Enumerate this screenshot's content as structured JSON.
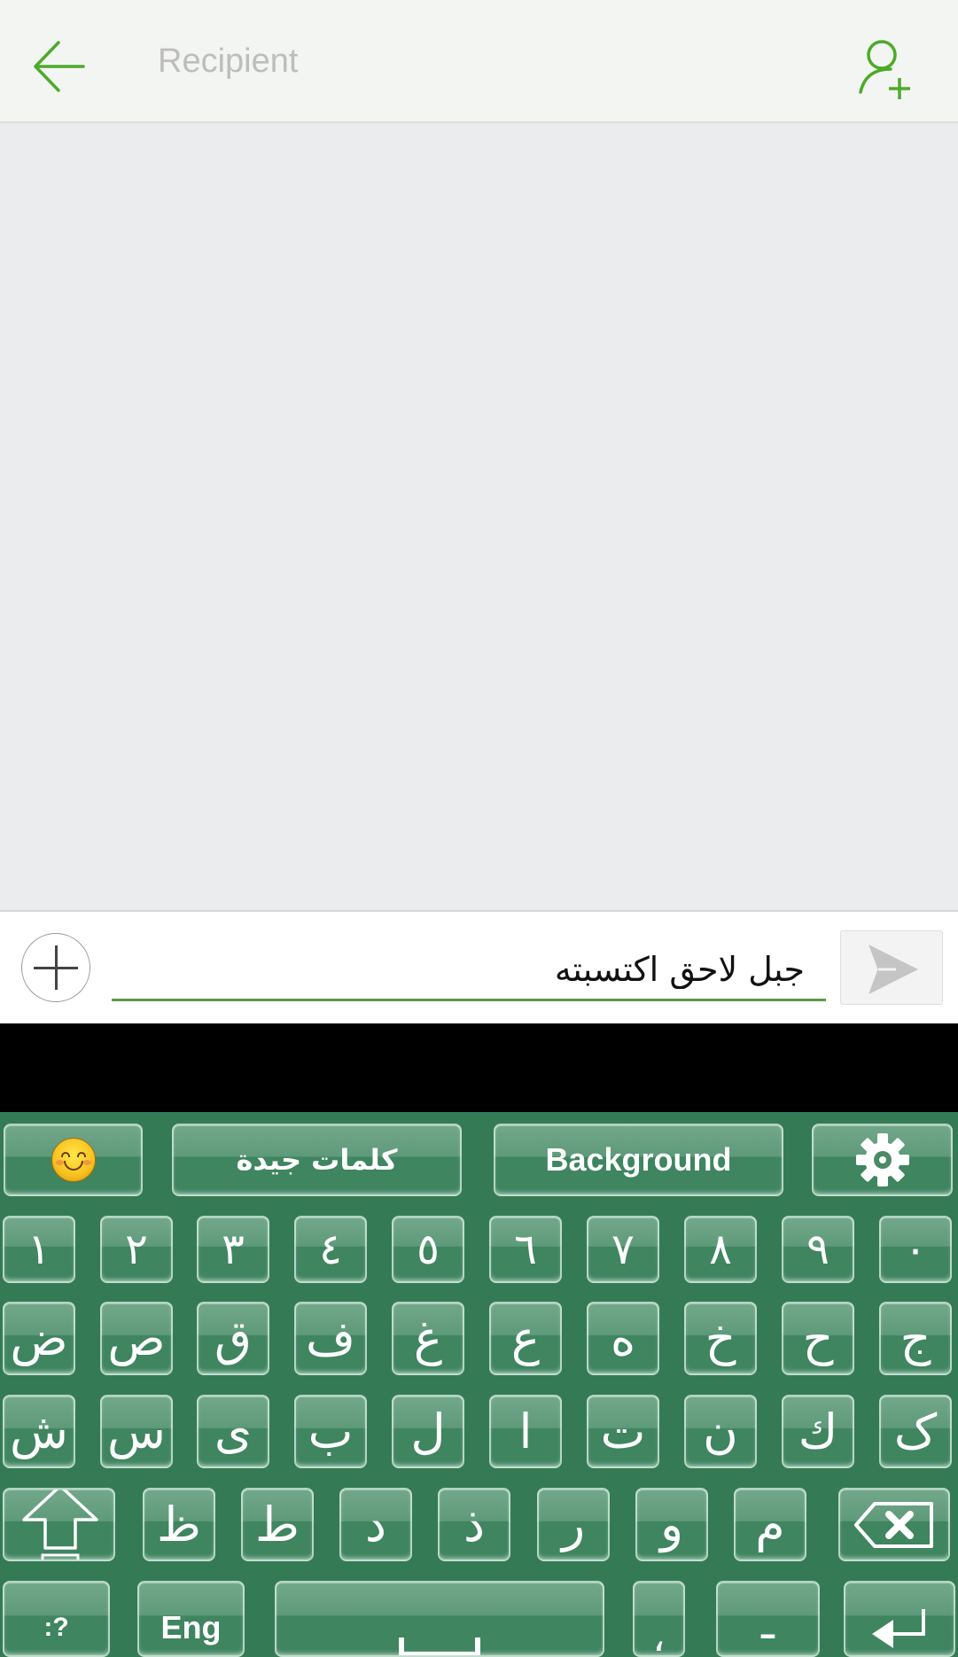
{
  "header": {
    "back_icon": "arrow-left-icon",
    "recipient_placeholder": "Recipient",
    "add_contact_icon": "person-add-icon",
    "accent_color": "#4caa2a"
  },
  "composer": {
    "attach_icon": "plus-circle-icon",
    "message_text": "جبل لاحق اكتسبته",
    "send_icon": "send-arrow-icon",
    "underline_color": "#5a9a46"
  },
  "keyboard": {
    "background_color": "#347b55",
    "toolbar": {
      "emoji_icon": "smiley-emoji-icon",
      "good_words_label": "كلمات جيدة",
      "background_label": "Background",
      "settings_icon": "gear-icon"
    },
    "number_row": [
      "١",
      "٢",
      "٣",
      "٤",
      "٥",
      "٦",
      "٧",
      "٨",
      "٩",
      "٠"
    ],
    "row2": [
      "ض",
      "ص",
      "ق",
      "ف",
      "غ",
      "ع",
      "ه",
      "خ",
      "ح",
      "ج"
    ],
    "row3": [
      "ش",
      "س",
      "ى",
      "ب",
      "ل",
      "ا",
      "ت",
      "ن",
      "ك",
      "ک"
    ],
    "row4": [
      "ظ",
      "ط",
      "د",
      "ذ",
      "ر",
      "و",
      "م"
    ],
    "row4_shift_icon": "shift-arrow-icon",
    "row4_backspace_icon": "backspace-icon",
    "bottom_row": {
      "symbols_label": ":?",
      "language_label": "Eng",
      "space_icon": "spacebar-icon",
      "comma_label": "،",
      "dash_label": "ـ",
      "enter_icon": "enter-icon"
    }
  }
}
